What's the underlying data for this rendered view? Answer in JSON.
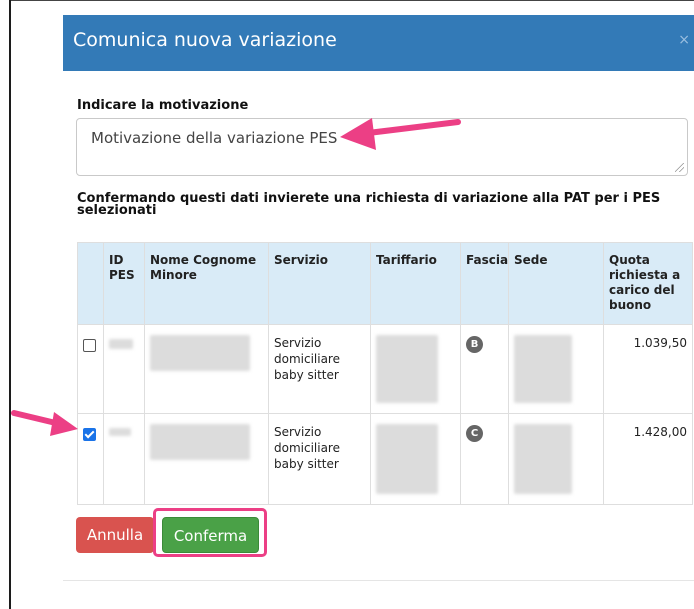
{
  "modal": {
    "title": "Comunica nuova variazione",
    "close_icon": "×"
  },
  "motivation": {
    "label": "Indicare la motivazione",
    "value": "Motivazione della variazione PES"
  },
  "confirm_text": "Confermando questi dati invierete una richiesta di variazione alla PAT per i PES selezionati",
  "table": {
    "headers": [
      "",
      "ID PES",
      "Nome Cognome Minore",
      "Servizio",
      "Tariffario",
      "Fascia",
      "Sede",
      "Quota richiesta a carico del buono"
    ],
    "rows": [
      {
        "checked": false,
        "servizio": "Servizio domiciliare baby sitter",
        "fascia": "B",
        "quota": "1.039,50"
      },
      {
        "checked": true,
        "servizio": "Servizio domiciliare baby sitter",
        "fascia": "C",
        "quota": "1.428,00"
      }
    ]
  },
  "buttons": {
    "cancel": "Annulla",
    "confirm": "Conferma"
  },
  "colors": {
    "header_bg": "#337ab7",
    "table_header_bg": "#d9ebf7",
    "cancel_bg": "#d9534f",
    "confirm_bg": "#4aa147",
    "annotation_pink": "#ec3f85"
  },
  "icons": [
    "close-icon",
    "resize-grip-icon",
    "checkbox-icon",
    "arrow-annotation-icon"
  ]
}
